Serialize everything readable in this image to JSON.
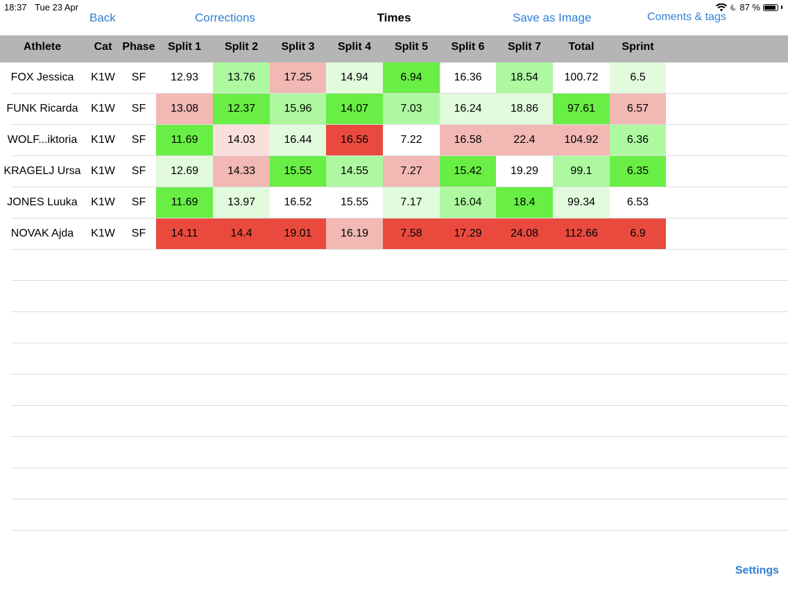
{
  "status_bar": {
    "time": "18:37",
    "date": "Tue 23 Apr",
    "battery": "87 %",
    "battery_level": 0.87
  },
  "nav": {
    "back": "Back",
    "corrections": "Corrections",
    "title": "Times",
    "save_image": "Save as Image",
    "comments": "Coments & tags"
  },
  "columns": [
    "Athlete",
    "Cat",
    "Phase",
    "Split 1",
    "Split 2",
    "Split 3",
    "Split 4",
    "Split 5",
    "Split 6",
    "Split 7",
    "Total",
    "Sprint"
  ],
  "rows": [
    {
      "athlete": "FOX Jessica",
      "cat": "K1W",
      "phase": "SF",
      "values": [
        "12.93",
        "13.76",
        "17.25",
        "14.94",
        "6.94",
        "16.36",
        "18.54",
        "100.72",
        "6.5"
      ],
      "colors": [
        "#ffffff",
        "#aef9a0",
        "#f2b8b4",
        "#e2fbdd",
        "#69ee45",
        "#ffffff",
        "#aef9a0",
        "#ffffff",
        "#e2fbdd"
      ]
    },
    {
      "athlete": "FUNK Ricarda",
      "cat": "K1W",
      "phase": "SF",
      "values": [
        "13.08",
        "12.37",
        "15.96",
        "14.07",
        "7.03",
        "16.24",
        "18.86",
        "97.61",
        "6.57"
      ],
      "colors": [
        "#f2b8b4",
        "#69ee45",
        "#aef9a0",
        "#69ee45",
        "#aef9a0",
        "#e2fbdd",
        "#e2fbdd",
        "#69ee45",
        "#f2b8b4"
      ]
    },
    {
      "athlete": "WOLF...iktoria",
      "cat": "K1W",
      "phase": "SF",
      "values": [
        "11.69",
        "14.03",
        "16.44",
        "16.56",
        "7.22",
        "16.58",
        "22.4",
        "104.92",
        "6.36"
      ],
      "colors": [
        "#69ee45",
        "#fae0dd",
        "#e2fbdd",
        "#ea4a3e",
        "#ffffff",
        "#f2b8b4",
        "#f2b8b4",
        "#f2b8b4",
        "#aef9a0"
      ]
    },
    {
      "athlete": "KRAGELJ Ursa",
      "cat": "K1W",
      "phase": "SF",
      "values": [
        "12.69",
        "14.33",
        "15.55",
        "14.55",
        "7.27",
        "15.42",
        "19.29",
        "99.1",
        "6.35"
      ],
      "colors": [
        "#e2fbdd",
        "#f2b8b4",
        "#69ee45",
        "#aef9a0",
        "#f2b8b4",
        "#69ee45",
        "#ffffff",
        "#aef9a0",
        "#69ee45"
      ]
    },
    {
      "athlete": "JONES Luuka",
      "cat": "K1W",
      "phase": "SF",
      "values": [
        "11.69",
        "13.97",
        "16.52",
        "15.55",
        "7.17",
        "16.04",
        "18.4",
        "99.34",
        "6.53"
      ],
      "colors": [
        "#69ee45",
        "#e2fbdd",
        "#ffffff",
        "#ffffff",
        "#e2fbdd",
        "#aef9a0",
        "#69ee45",
        "#e2fbdd",
        "#ffffff"
      ]
    },
    {
      "athlete": "NOVAK Ajda",
      "cat": "K1W",
      "phase": "SF",
      "values": [
        "14.11",
        "14.4",
        "19.01",
        "16.19",
        "7.58",
        "17.29",
        "24.08",
        "112.66",
        "6.9"
      ],
      "colors": [
        "#ea4a3e",
        "#ea4a3e",
        "#ea4a3e",
        "#f2b8b4",
        "#ea4a3e",
        "#ea4a3e",
        "#ea4a3e",
        "#ea4a3e",
        "#ea4a3e"
      ]
    }
  ],
  "settings": "Settings"
}
